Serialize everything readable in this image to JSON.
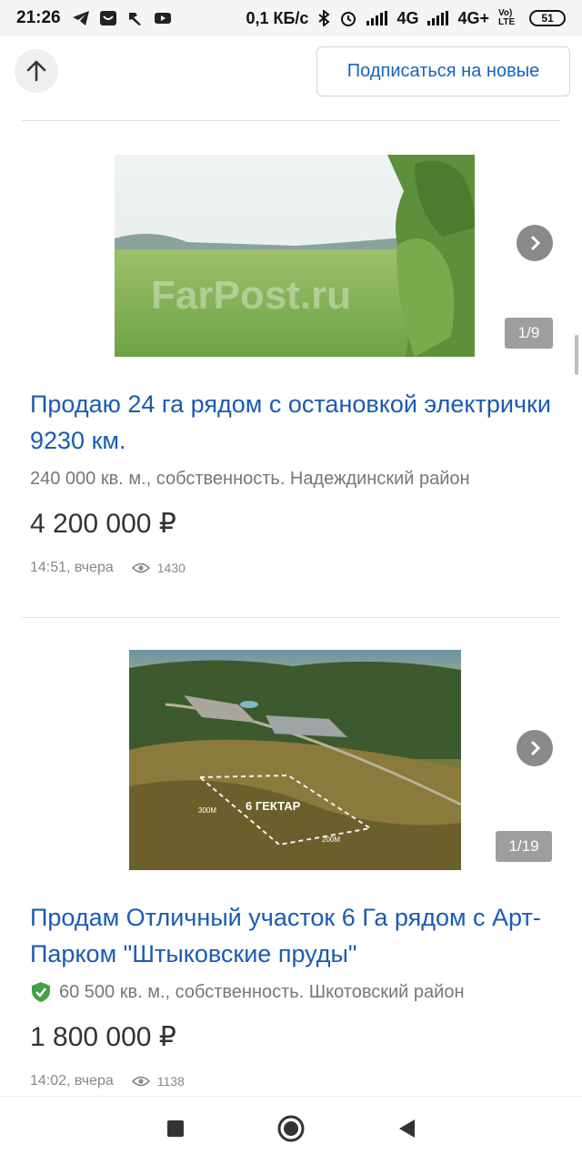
{
  "status_bar": {
    "time": "21:26",
    "network_speed": "0,1 КБ/с",
    "net1": "4G",
    "net2": "4G+",
    "volte": "Vo) LTE",
    "battery": "51"
  },
  "top_bar": {
    "up_icon": "arrow-up-icon",
    "subscribe_label": "Подписаться на новые"
  },
  "listings": [
    {
      "title": "Продаю 24 га рядом с остановкой электрички 9230 км.",
      "details": "240 000 кв. м., собственность. Надеждинский район",
      "price": "4 200 000 ₽",
      "posted": "14:51, вчера",
      "views": "1430",
      "photo_counter": "1/9",
      "photo_watermark": "FarPost.ru",
      "verified": false
    },
    {
      "title": "Продам Отличный участок 6 Га рядом с Арт-Парком \"Штыковские пруды\"",
      "details": "60 500 кв. м., собственность. Шкотовский район",
      "price": "1 800 000 ₽",
      "posted": "14:02, вчера",
      "views": "1138",
      "photo_counter": "1/19",
      "photo_area_label": "6 ГЕКТАР",
      "photo_side_a": "300М",
      "photo_side_b": "200М",
      "verified": true
    }
  ],
  "nav": {
    "recents": "square-icon",
    "home": "circle-icon",
    "back": "triangle-back-icon"
  },
  "colors": {
    "link": "#1a5bb4",
    "accent": "#1565c0",
    "verified": "#43a047"
  }
}
